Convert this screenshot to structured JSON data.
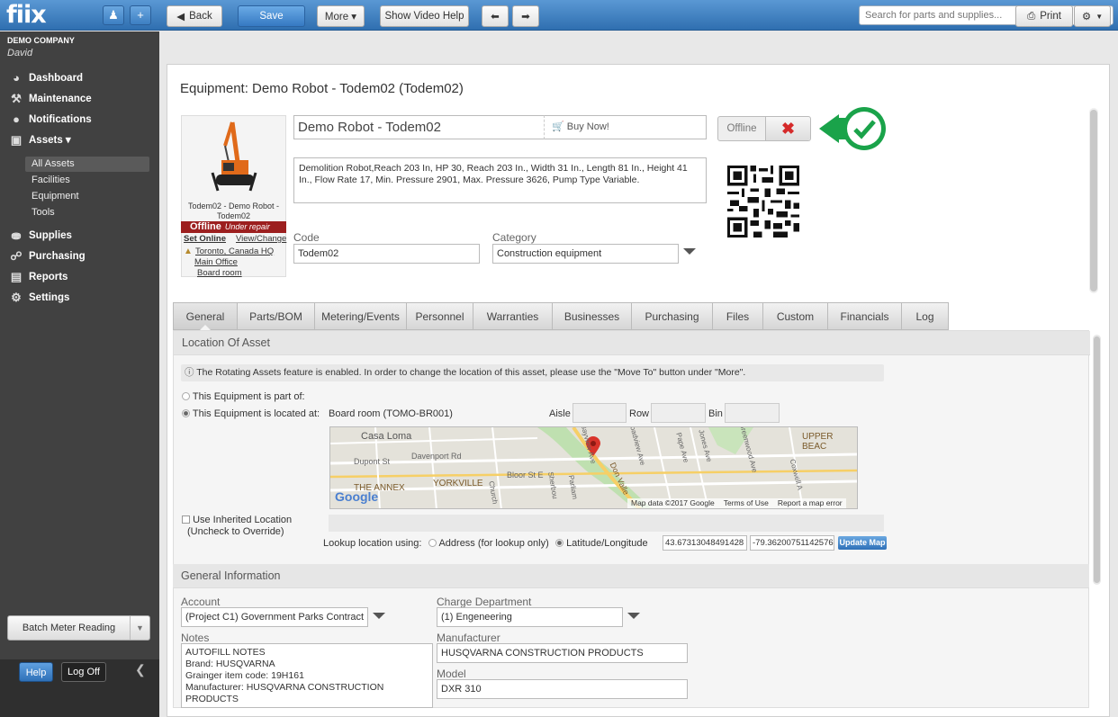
{
  "app": {
    "logo": "fiix",
    "search_placeholder": "Search for parts and supplies..."
  },
  "sidebar": {
    "company": "DEMO COMPANY",
    "user": "David",
    "nav": [
      {
        "label": "Dashboard",
        "icon": "dashboard-icon"
      },
      {
        "label": "Maintenance",
        "icon": "wrench-icon"
      },
      {
        "label": "Notifications",
        "icon": "chat-bubble-icon"
      },
      {
        "label": "Assets ▾",
        "icon": "box-icon"
      },
      {
        "label": "Supplies",
        "icon": "truck-icon"
      },
      {
        "label": "Purchasing",
        "icon": "cart-icon"
      },
      {
        "label": "Reports",
        "icon": "chart-icon"
      },
      {
        "label": "Settings",
        "icon": "gear-icon"
      }
    ],
    "assets_sub": [
      "All Assets",
      "Facilities",
      "Equipment",
      "Tools"
    ],
    "batch_meter": "Batch Meter Reading",
    "help": "Help",
    "logoff": "Log Off"
  },
  "toolbar": {
    "back": "Back",
    "save": "Save",
    "more": "More ▾",
    "video": "Show Video Help",
    "print": "Print"
  },
  "equipment": {
    "title": "Equipment: Demo Robot - Todem02 (Todem02)",
    "image_caption": "Todem02 - Demo Robot - Todem02",
    "status": "Offline",
    "status_note": "Under repair",
    "set_online": "Set Online",
    "view_change": "View/Change",
    "loc_city": "Toronto, Canada HQ",
    "loc_office": "Main Office",
    "loc_room": "Board room",
    "name": "Demo Robot - Todem02",
    "buy_now": "Buy Now!",
    "description": "Demolition Robot,Reach 203 In, HP 30, Reach 203 In., Width 31 In., Length 81 In., Height 41 In., Flow Rate 17, Min. Pressure 2901, Max. Pressure 3626, Pump Type Variable.",
    "code_label": "Code",
    "code": "Todem02",
    "category_label": "Category",
    "category": "Construction equipment",
    "toggle_label": "Offline"
  },
  "tabs": [
    "General",
    "Parts/BOM",
    "Metering/Events",
    "Personnel",
    "Warranties",
    "Businesses",
    "Purchasing",
    "Files",
    "Custom",
    "Financials",
    "Log"
  ],
  "location": {
    "heading": "Location Of Asset",
    "info": "The Rotating Assets feature is enabled. In order to change the location of this asset, please use the \"Move To\" button under \"More\".",
    "part_of": "This Equipment is part of:",
    "located_at": "This Equipment is located at:",
    "location_value": "Board room (TOMO-BR001)",
    "aisle": "Aisle",
    "row": "Row",
    "bin": "Bin",
    "inherited": "Use Inherited Location",
    "uncheck": "(Uncheck to Override)",
    "lookup": "Lookup location using:",
    "address_opt": "Address (for lookup only)",
    "latlng_opt": "Latitude/Longitude",
    "lat": "43.67313048491428",
    "lng": "-79.36200751142576",
    "update_map": "Update Map",
    "map": {
      "places": [
        "Casa Loma",
        "Dupont St",
        "Davenport Rd",
        "THE ANNEX",
        "YORKVILLE",
        "Bloor St E",
        "UPPER BEAC",
        "Don Valle",
        "Bayview Ave",
        "Broadview Ave",
        "Pape Ave",
        "Jones Ave",
        "Greenwood Ave",
        "Coxwell A",
        "Sherbou",
        "Church",
        "Parliam"
      ],
      "google": "Google",
      "mapdata": "Map data ©2017 Google",
      "terms": "Terms of Use",
      "report": "Report a map error"
    }
  },
  "general": {
    "heading": "General Information",
    "account_label": "Account",
    "account": "(Project C1) Government Parks Contract",
    "charge_label": "Charge Department",
    "charge": "(1) Engeneering",
    "notes_label": "Notes",
    "notes": "AUTOFILL NOTES\nBrand: HUSQVARNA\nGrainger item code: 19H161\nManufacturer: HUSQVARNA CONSTRUCTION\nPRODUCTS",
    "manufacturer_label": "Manufacturer",
    "manufacturer": "HUSQVARNA CONSTRUCTION PRODUCTS",
    "model_label": "Model",
    "model": "DXR 310"
  }
}
